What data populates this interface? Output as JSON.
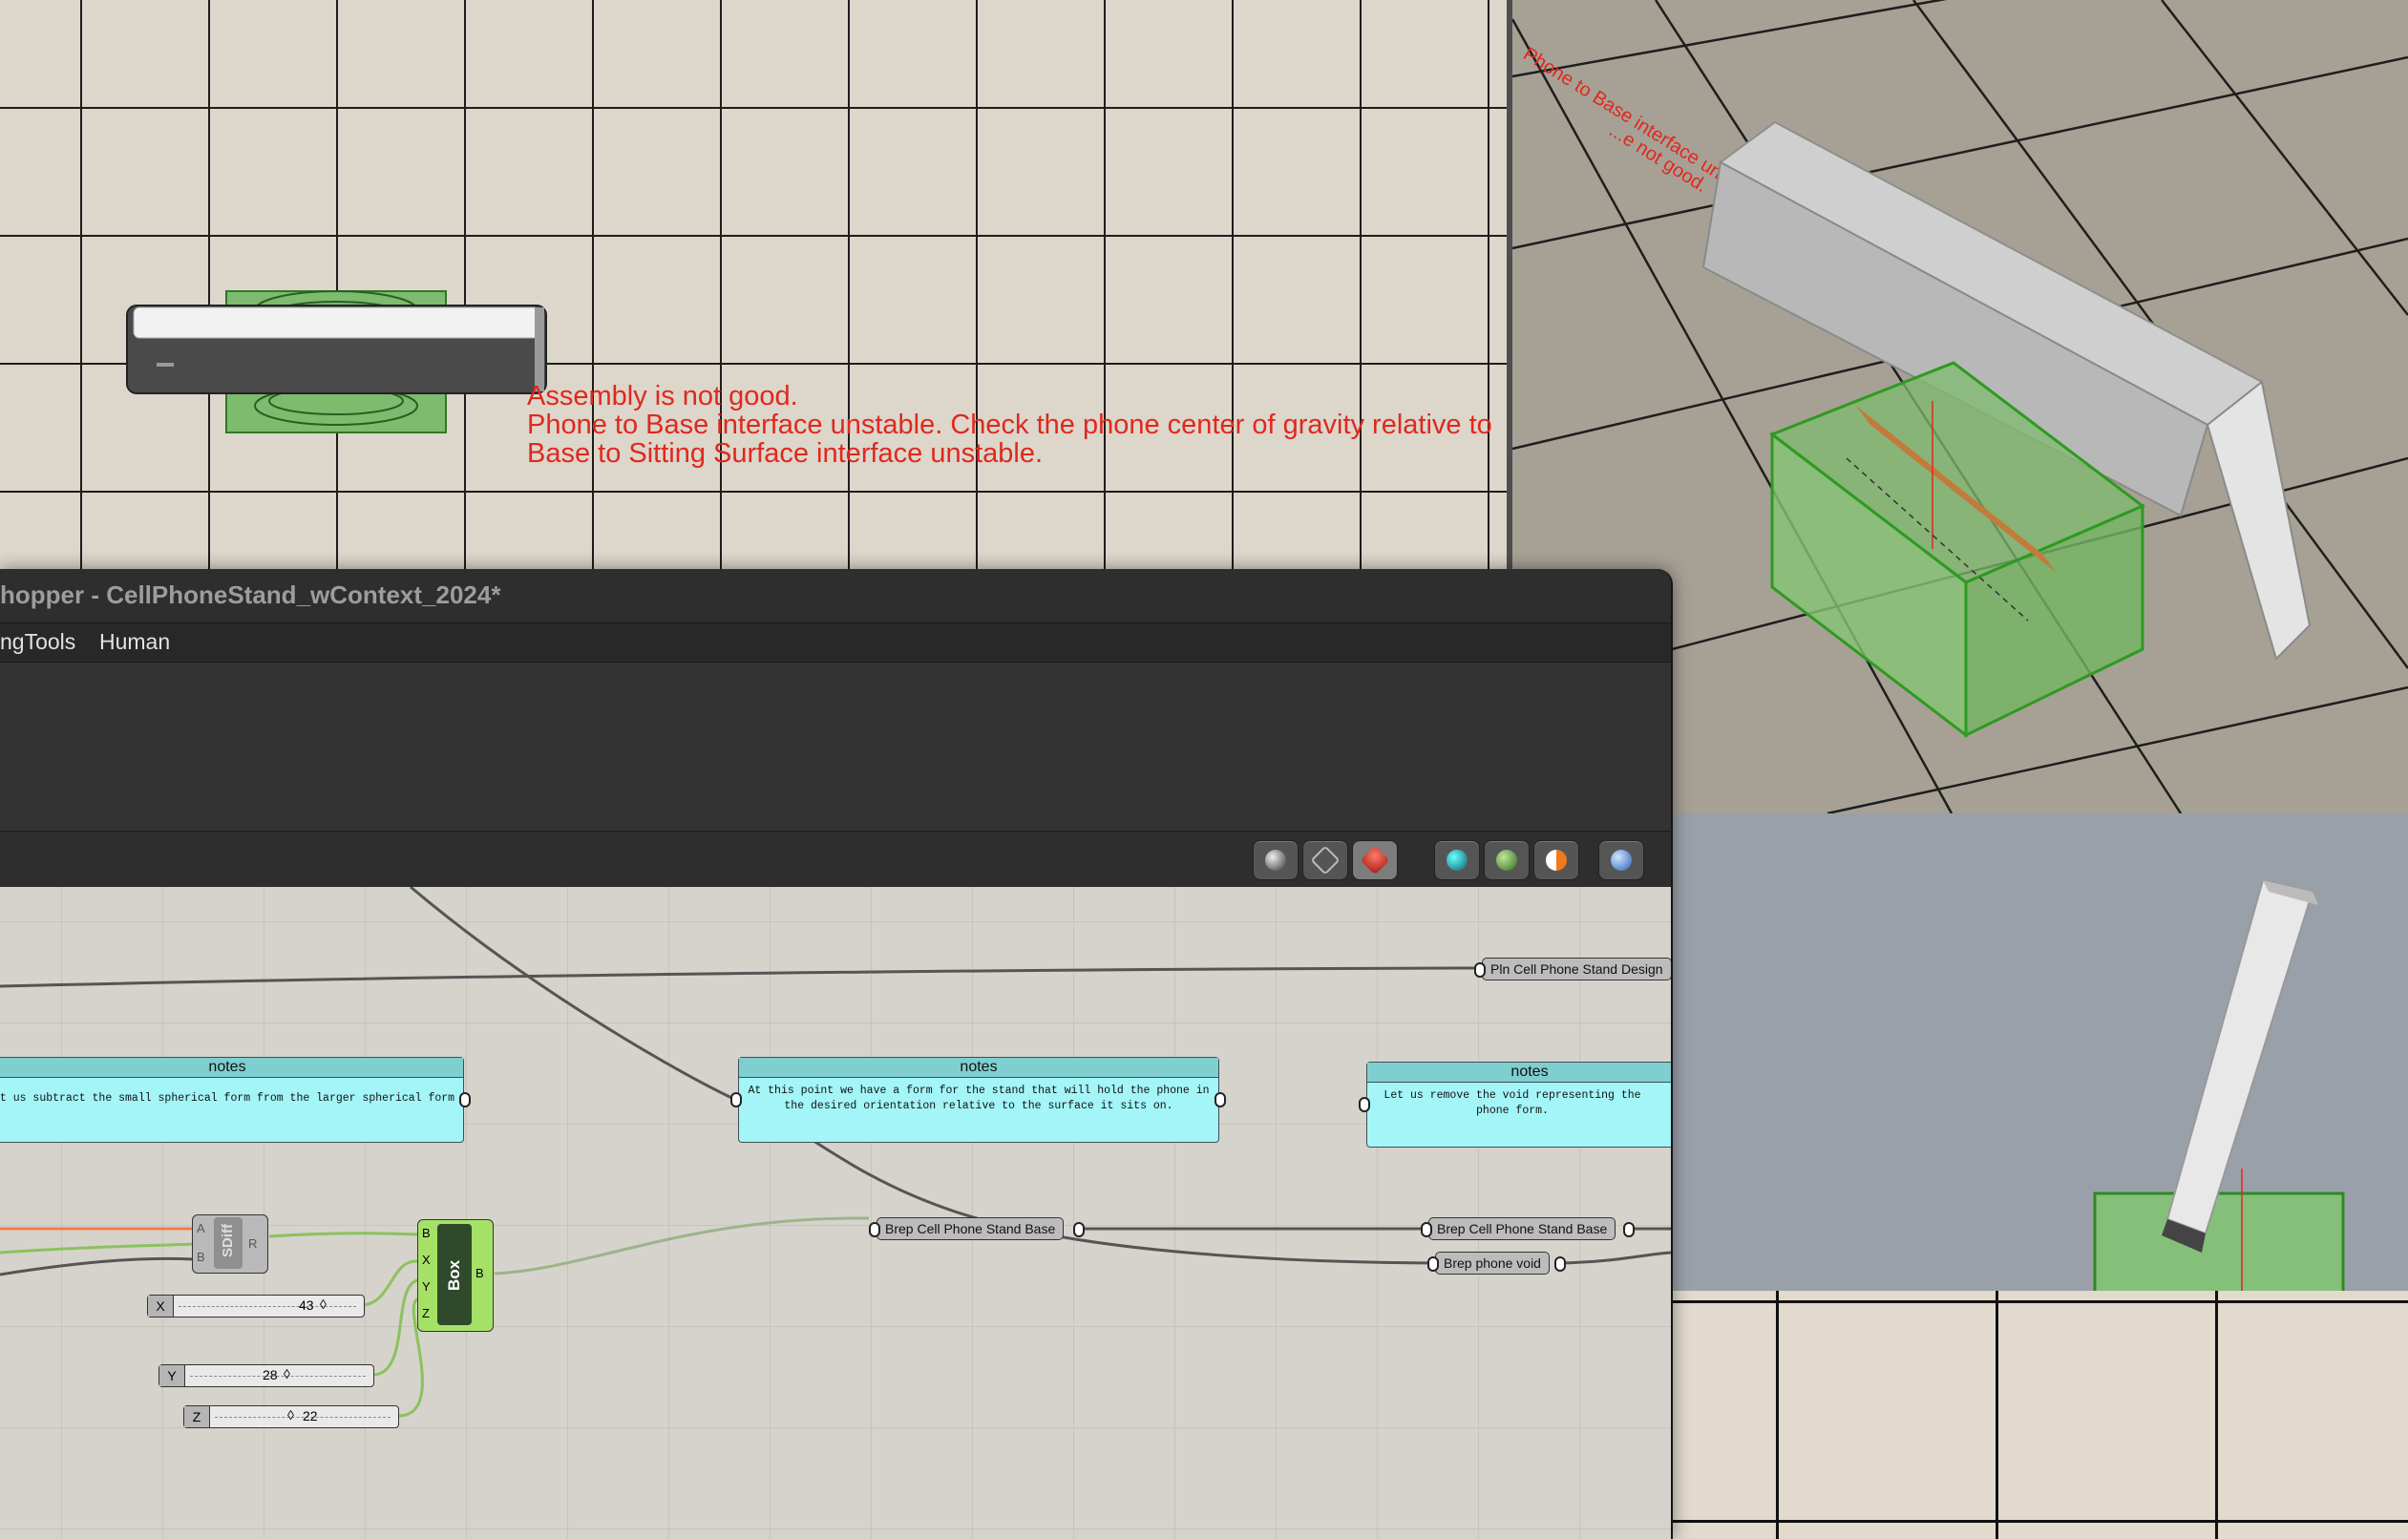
{
  "viewport_top": {
    "warnings": [
      "Assembly is not good.",
      "Phone to Base interface unstable. Check the phone center of gravity relative to",
      "Base to Sitting Surface interface unstable."
    ],
    "colors": {
      "warning": "#e0281f",
      "base": "#7dbb6e",
      "grid": "#1d1d1d"
    }
  },
  "viewport_perspective": {
    "rotated_text": [
      "...e not good.",
      "Phone to Base interface unstable. Check the phone center o..."
    ]
  },
  "grasshopper": {
    "title": "hopper - CellPhoneStand_wContext_2024*",
    "menu": [
      "ngTools",
      "Human"
    ],
    "toolbar_icons": [
      "preview-off-icon",
      "preview-wireframe-icon",
      "preview-shaded-icon",
      "solid-icon",
      "mesh-icon",
      "render-icon",
      "sphere-icon"
    ],
    "notes": [
      {
        "title": "notes",
        "text": "t us subtract the small spherical form from the larger spherical form"
      },
      {
        "title": "notes",
        "text": "At this point we have a form for the stand that will hold the phone in the desired orientation relative to the surface it sits on."
      },
      {
        "title": "notes",
        "text": "Let us remove the void representing the phone form."
      }
    ],
    "params": {
      "pln_design": "Pln Cell Phone Stand Design",
      "brep_base_1": "Brep Cell Phone Stand Base",
      "brep_base_2": "Brep Cell Phone Stand Base",
      "brep_void": "Brep phone void"
    },
    "components": {
      "sdiff": {
        "name": "SDiff",
        "inputs": [
          "A",
          "B"
        ],
        "output": "R"
      },
      "box": {
        "name": "Box",
        "inputs": [
          "B",
          "X",
          "Y",
          "Z"
        ],
        "output": "B"
      }
    },
    "sliders": [
      {
        "label": "X",
        "value": "43"
      },
      {
        "label": "Y",
        "value": "28"
      },
      {
        "label": "Z",
        "value": "22"
      }
    ]
  }
}
